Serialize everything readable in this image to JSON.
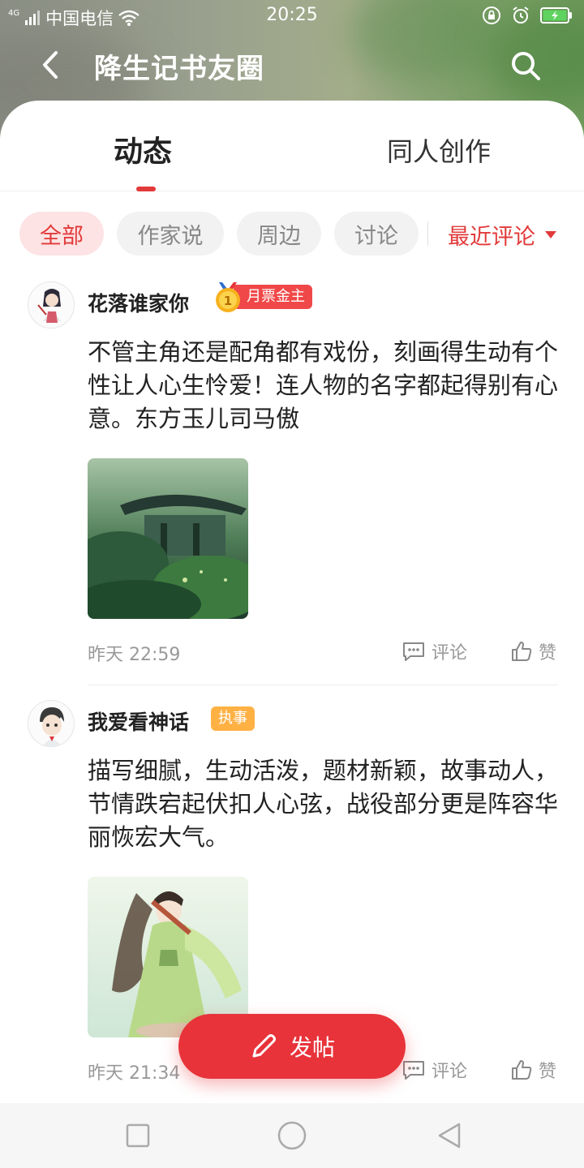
{
  "status_bar": {
    "network": "4G",
    "carrier": "中国电信",
    "time": "20:25"
  },
  "header": {
    "title": "降生记书友圈",
    "back_icon": "chevron-left-icon",
    "search_icon": "search-icon"
  },
  "tabs": [
    {
      "label": "动态",
      "active": true
    },
    {
      "label": "同人创作",
      "active": false
    }
  ],
  "filters": {
    "chips": [
      {
        "label": "全部",
        "active": true
      },
      {
        "label": "作家说",
        "active": false
      },
      {
        "label": "周边",
        "active": false
      },
      {
        "label": "讨论",
        "active": false
      }
    ],
    "sort_label": "最近评论"
  },
  "posts": [
    {
      "username": "花落谁家你",
      "badge": "月票金主",
      "text": "不管主角还是配角都有戏份，刻画得生动有个性让人心生怜爱！连人物的名字都起得别有心意。东方玉儿司马傲",
      "time": "昨天 22:59",
      "comment_label": "评论",
      "like_label": "赞"
    },
    {
      "username": "我爱看神话",
      "badge": "执事",
      "text": "描写细腻，生动活泼，题材新颖，故事动人，节情跌宕起伏扣人心弦，战役部分更是阵容华丽恢宏大气。",
      "time": "昨天 21:34",
      "comment_label": "评论",
      "like_label": "赞"
    }
  ],
  "fab": {
    "label": "发帖"
  },
  "colors": {
    "accent": "#e23a3a",
    "badge_gold_bg": "#f04848",
    "badge_role_bg": "#ffb144"
  }
}
